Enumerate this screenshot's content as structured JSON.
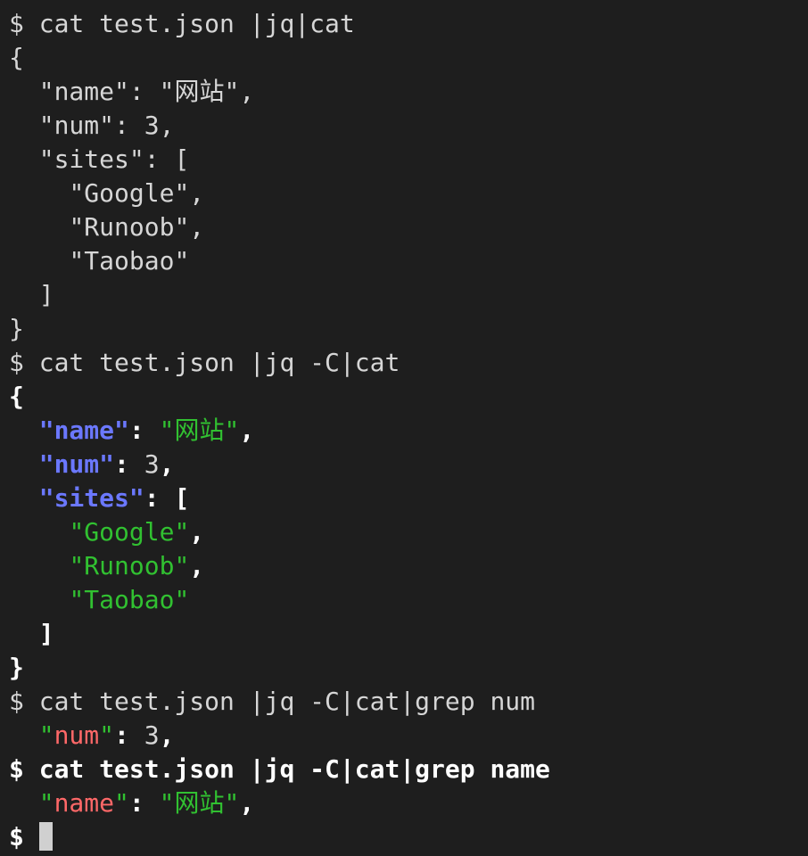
{
  "prompt_symbol": "$",
  "commands": {
    "cmd1": "cat test.json |jq|cat",
    "cmd2": "cat test.json |jq -C|cat",
    "cmd3": "cat test.json |jq -C|cat|grep num",
    "cmd4": "cat test.json |jq -C|cat|grep name"
  },
  "json": {
    "open_brace": "{",
    "close_brace": "}",
    "key_name": "\"name\"",
    "val_name": "\"网站\"",
    "key_num": "\"num\"",
    "val_num": "3",
    "key_sites": "\"sites\"",
    "open_bracket": "[",
    "close_bracket": "]",
    "site1": "\"Google\"",
    "site2": "\"Runoob\"",
    "site3": "\"Taobao\""
  },
  "punct": {
    "colon": ": ",
    "comma": ","
  },
  "colors": {
    "background": "#1e1e1e",
    "text": "#d6d6d6",
    "key_blue": "#6b78ff",
    "string_green": "#31c131",
    "match_red": "#ff6868"
  }
}
